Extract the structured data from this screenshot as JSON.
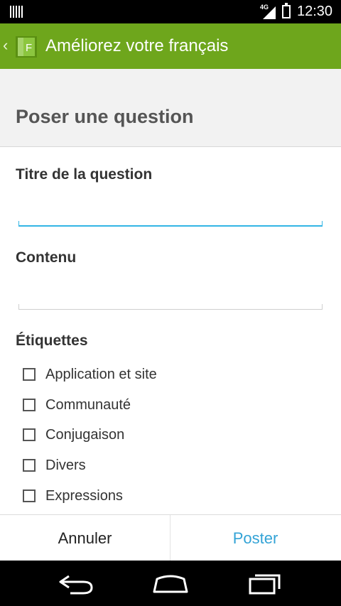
{
  "status_bar": {
    "network": "4G",
    "time": "12:30"
  },
  "action_bar": {
    "app_icon_letter": "F",
    "title": "Améliorez votre français"
  },
  "page": {
    "heading": "Poser une question"
  },
  "form": {
    "title_label": "Titre de la question",
    "title_value": "",
    "content_label": "Contenu",
    "content_value": "",
    "tags_label": "Étiquettes",
    "tags": [
      {
        "label": "Application et site",
        "checked": false
      },
      {
        "label": "Communauté",
        "checked": false
      },
      {
        "label": "Conjugaison",
        "checked": false
      },
      {
        "label": "Divers",
        "checked": false
      },
      {
        "label": "Expressions",
        "checked": false
      }
    ]
  },
  "buttons": {
    "cancel": "Annuler",
    "post": "Poster"
  },
  "colors": {
    "action_bar": "#6ea61c",
    "accent": "#33b5e5",
    "post_text": "#33a3d6"
  }
}
